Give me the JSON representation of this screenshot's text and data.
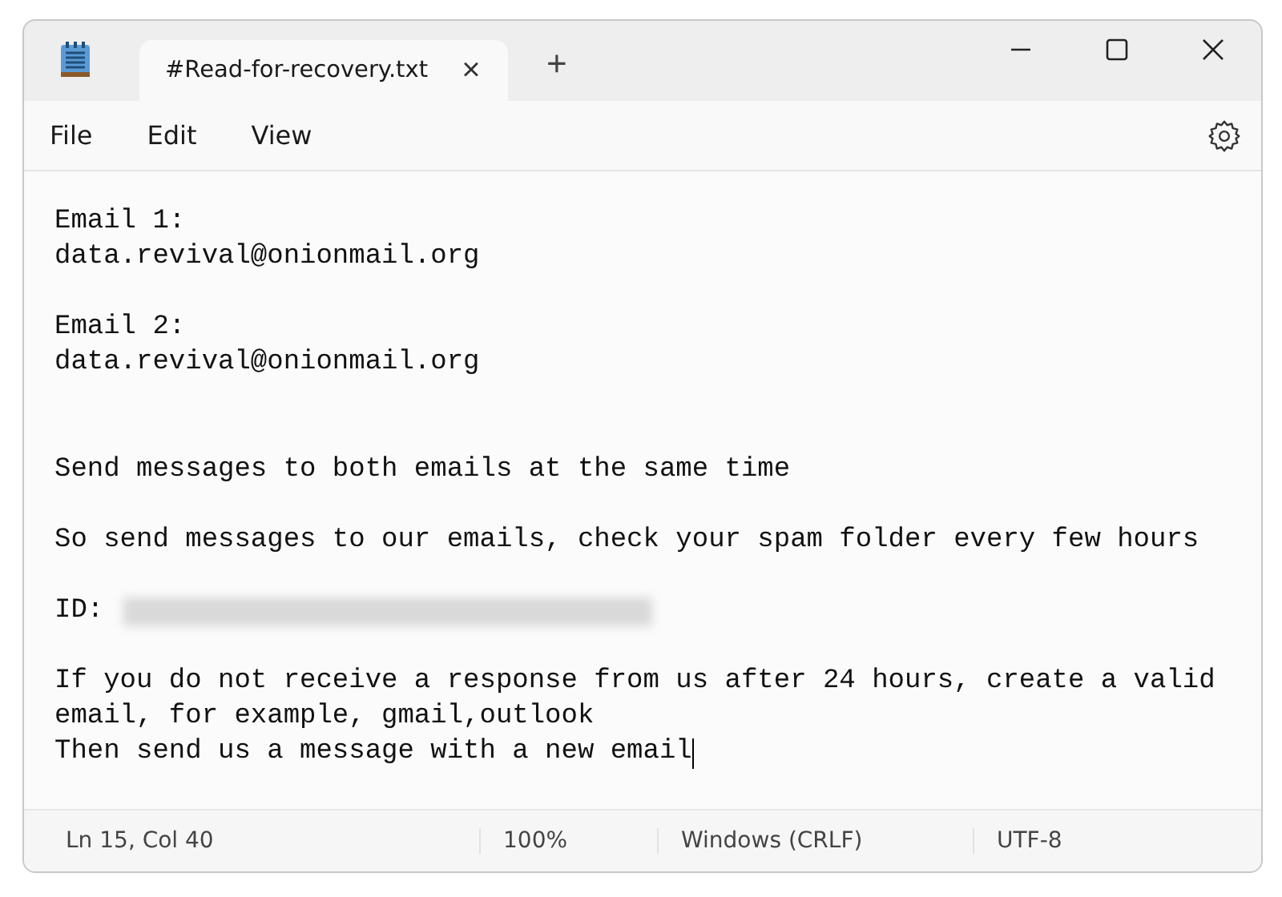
{
  "tabs": [
    {
      "label": "#Read-for-recovery.txt",
      "selected": true,
      "close": "×"
    }
  ],
  "new_tab": "+",
  "menu": [
    "File",
    "Edit",
    "View"
  ],
  "lines": [
    {
      "kind": "text",
      "text": "Email 1:",
      "caret": false
    },
    {
      "kind": "text",
      "text": "data.revival@onionmail.org",
      "caret": false
    },
    {
      "kind": "blank"
    },
    {
      "kind": "text",
      "text": "Email 2:",
      "caret": false
    },
    {
      "kind": "text",
      "text": "data.revival@onionmail.org",
      "caret": false
    },
    {
      "kind": "blank"
    },
    {
      "kind": "blank"
    },
    {
      "kind": "text",
      "text": "Send messages to both emails at the same time",
      "caret": false
    },
    {
      "kind": "blank"
    },
    {
      "kind": "text",
      "text": "So send messages to our emails, check your spam folder every few hours",
      "caret": false
    },
    {
      "kind": "blank"
    },
    {
      "kind": "redacted",
      "text": "ID:"
    },
    {
      "kind": "blank"
    },
    {
      "kind": "text",
      "text": "If you do not receive a response from us after 24 hours, create a valid",
      "caret": false
    },
    {
      "kind": "text",
      "text": "email, for example, gmail,outlook",
      "caret": false
    },
    {
      "kind": "text",
      "text": "Then send us a message with a new email",
      "caret": true
    }
  ],
  "status_bar": [
    "Ln 15, Col 40",
    "100%",
    "Windows (CRLF)",
    "UTF-8"
  ]
}
